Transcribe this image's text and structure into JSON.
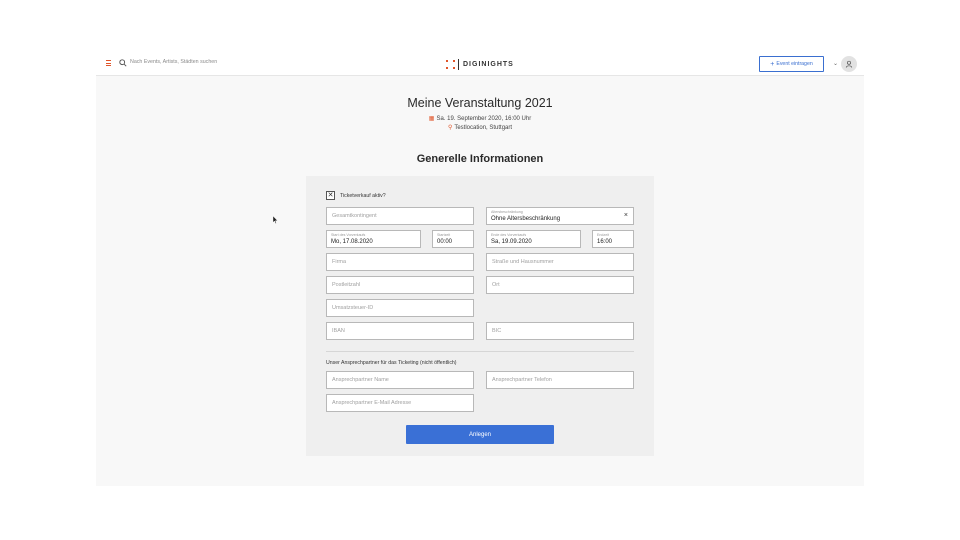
{
  "header": {
    "search_placeholder": "Nach Events, Artists, Städten suchen",
    "logo_text": "DIGINIGHTS",
    "event_button": "Event eintragen"
  },
  "event": {
    "title": "Meine Veranstaltung 2021",
    "date": "Sa. 19. September 2020, 16:00 Uhr",
    "location": "Testlocation, Stuttgart"
  },
  "form": {
    "heading": "Generelle Informationen",
    "ticket_sale_label": "Ticketverkauf aktiv?",
    "ticket_sale_checked": true,
    "total_quota_placeholder": "Gesamtkontingent",
    "age_restriction": {
      "label": "Altersbeschränkung",
      "value": "Ohne Altersbeschränkung"
    },
    "presale_start": {
      "label": "Start des Vorverkaufs",
      "value": "Mo, 17.08.2020"
    },
    "start_time": {
      "label": "Startzeit",
      "value": "00:00"
    },
    "presale_end": {
      "label": "Ende des Vorverkaufs",
      "value": "Sa, 19.09.2020"
    },
    "end_time": {
      "label": "Endzeit",
      "value": "16:00"
    },
    "company_placeholder": "Firma",
    "street_placeholder": "Straße und Hausnummer",
    "zip_placeholder": "Postleitzahl",
    "city_placeholder": "Ort",
    "vat_placeholder": "Umsatzsteuer-ID",
    "iban_placeholder": "IBAN",
    "bic_placeholder": "BIC",
    "contact_section_label": "Unser Ansprechpartner für das Ticketing (nicht öffentlich)",
    "contact_name_placeholder": "Ansprechpartner Name",
    "contact_phone_placeholder": "Ansprechpartner Telefon",
    "contact_email_placeholder": "Ansprechpartner E-Mail Adresse",
    "submit_label": "Anlegen"
  },
  "colors": {
    "accent": "#e0552a",
    "primary": "#3a70d6"
  }
}
